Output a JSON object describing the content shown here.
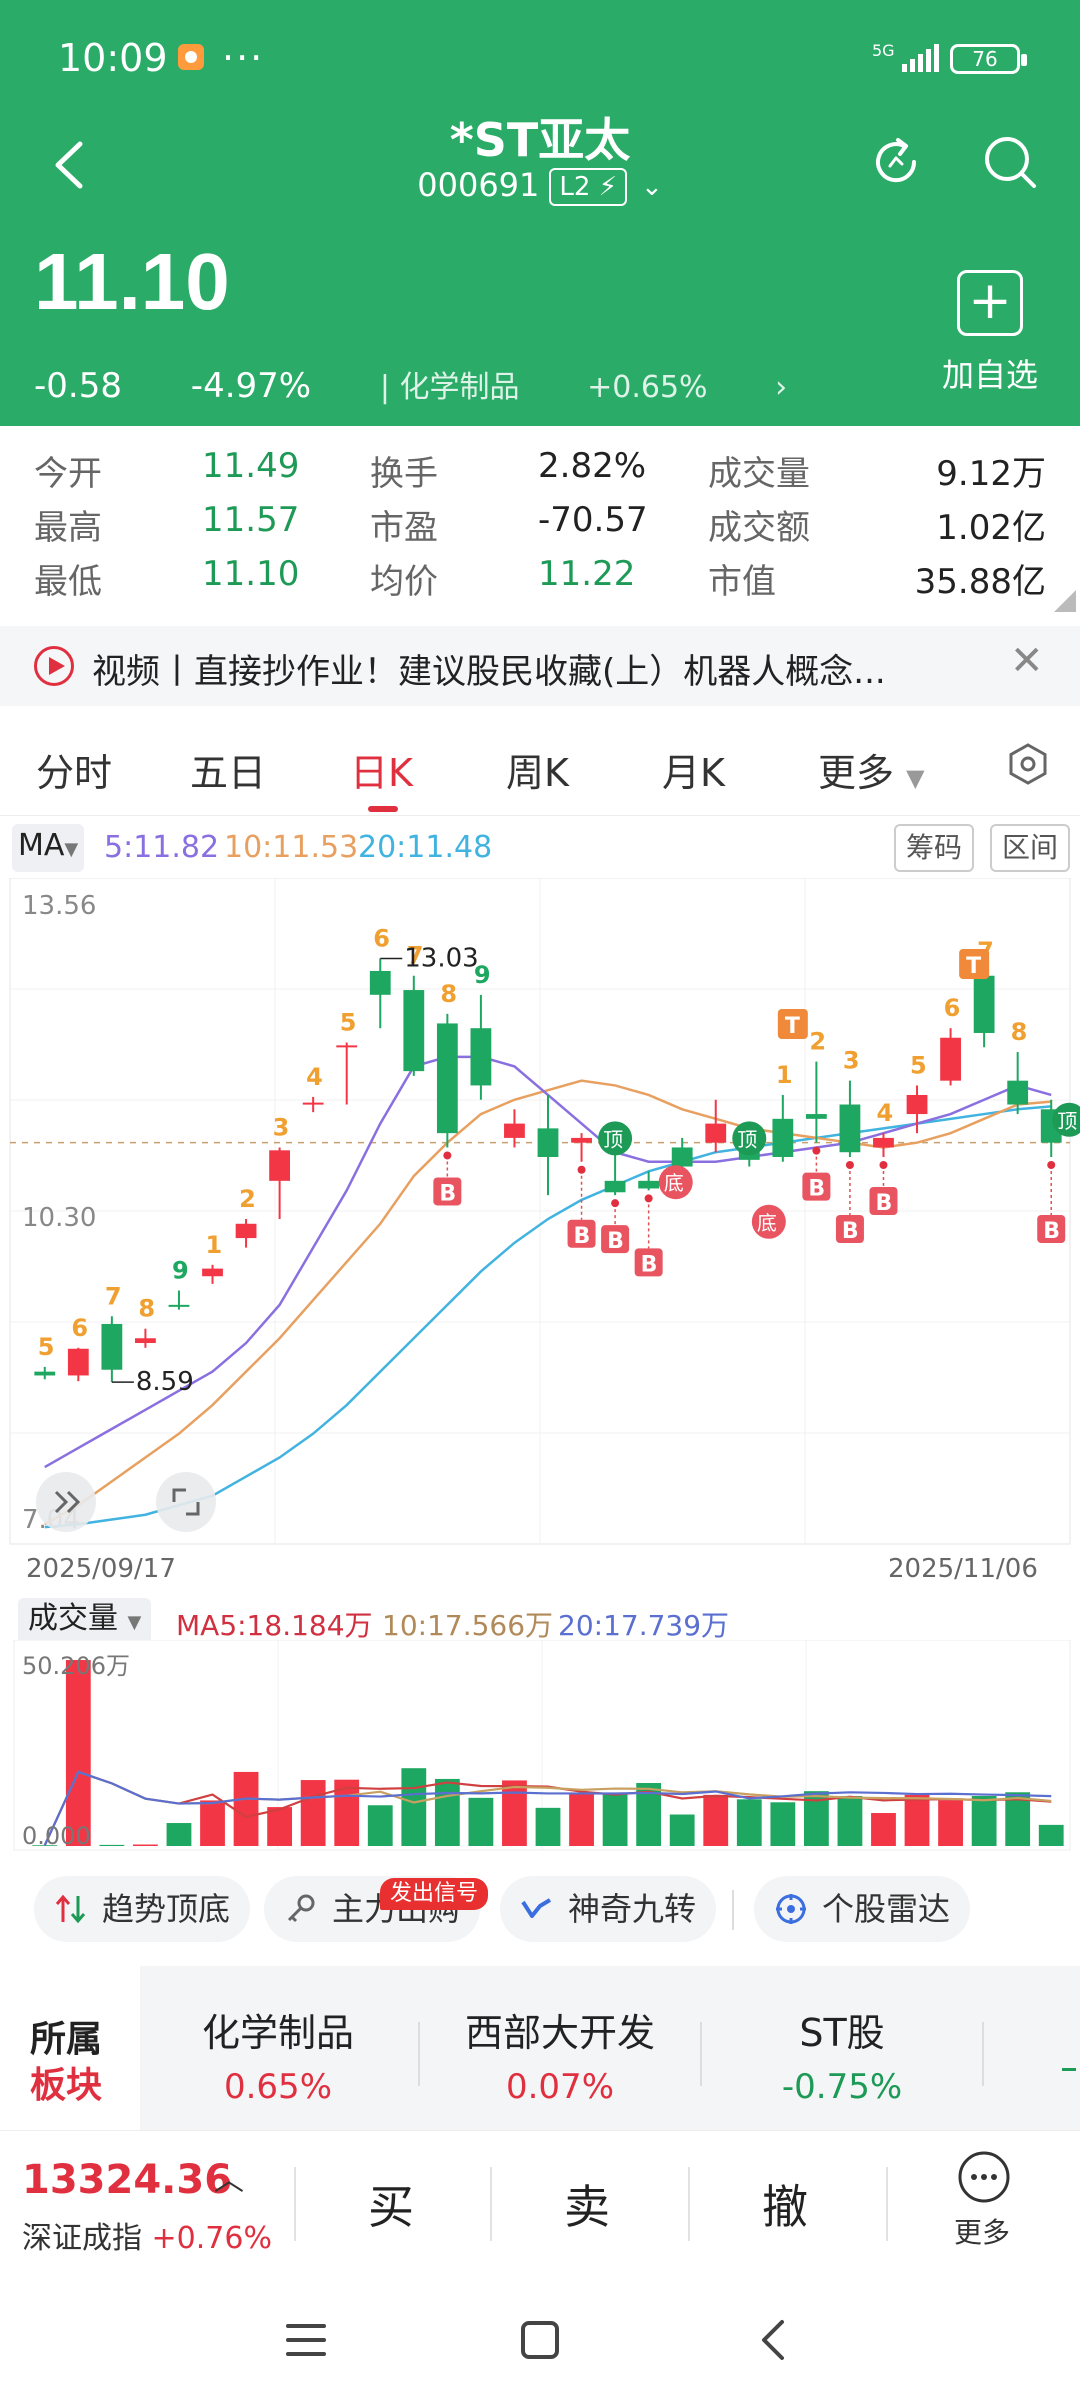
{
  "status": {
    "time": "10:09",
    "dots": "···",
    "net": "5G",
    "battery": "76"
  },
  "header": {
    "title": "*ST亚太",
    "code": "000691",
    "level": "L2",
    "price": "11.10",
    "change": "-0.58",
    "change_pct": "-4.97%",
    "sector": "化学制品",
    "sector_pct": "+0.65%",
    "add_fav": "加自选"
  },
  "stats": [
    {
      "label": "今开",
      "value": "11.49"
    },
    {
      "label": "换手",
      "value": "2.82%"
    },
    {
      "label": "成交量",
      "value": "9.12万"
    },
    {
      "label": "最高",
      "value": "11.57"
    },
    {
      "label": "市盈",
      "value": "-70.57"
    },
    {
      "label": "成交额",
      "value": "1.02亿"
    },
    {
      "label": "最低",
      "value": "11.10"
    },
    {
      "label": "均价",
      "value": "11.22"
    },
    {
      "label": "市值",
      "value": "35.88亿"
    }
  ],
  "news": {
    "text": "视频丨直接抄作业！建议股民收藏(上）机器人概念..."
  },
  "tabs": [
    "分时",
    "五日",
    "日K",
    "周K",
    "月K",
    "更多"
  ],
  "ma_legend": {
    "label": "MA",
    "ma5": "5:11.82",
    "ma10": "10:11.53",
    "ma20": "20:11.48",
    "chip1": "筹码",
    "chip2": "区间"
  },
  "chart_data": {
    "type": "candlestick",
    "dates_shown": [
      "2025/09/17",
      "2025/11/06"
    ],
    "y_labels": [
      "13.56",
      "10.30",
      "7.04"
    ],
    "ylim": [
      7.04,
      13.56
    ],
    "ref_price": 11.1,
    "high_marker": "13.03",
    "low_marker": "8.59",
    "candles": [
      {
        "o": 8.7,
        "h": 8.75,
        "l": 8.62,
        "c": 8.66,
        "n": "5"
      },
      {
        "o": 8.66,
        "h": 8.95,
        "l": 8.6,
        "c": 8.94,
        "n": "6"
      },
      {
        "o": 9.2,
        "h": 9.28,
        "l": 8.59,
        "c": 8.72,
        "n": "7"
      },
      {
        "o": 9.0,
        "h": 9.15,
        "l": 8.95,
        "c": 9.05,
        "n": "8"
      },
      {
        "o": 9.4,
        "h": 9.55,
        "l": 9.35,
        "c": 9.38,
        "n": "9"
      },
      {
        "o": 9.7,
        "h": 9.82,
        "l": 9.62,
        "c": 9.78,
        "n": "1"
      },
      {
        "o": 10.1,
        "h": 10.3,
        "l": 10.0,
        "c": 10.25,
        "n": "2"
      },
      {
        "o": 10.7,
        "h": 11.05,
        "l": 10.3,
        "c": 11.02,
        "n": "3"
      },
      {
        "o": 11.5,
        "h": 11.58,
        "l": 11.42,
        "c": 11.52,
        "n": "4"
      },
      {
        "o": 12.1,
        "h": 12.15,
        "l": 11.5,
        "c": 12.12,
        "n": "5"
      },
      {
        "o": 12.9,
        "h": 13.03,
        "l": 12.3,
        "c": 12.65,
        "n": "6"
      },
      {
        "o": 12.7,
        "h": 12.85,
        "l": 11.8,
        "c": 11.85,
        "n": "7"
      },
      {
        "o": 12.35,
        "h": 12.45,
        "l": 11.05,
        "c": 11.2,
        "n": "8"
      },
      {
        "o": 12.3,
        "h": 12.65,
        "l": 11.55,
        "c": 11.7,
        "n": "9"
      },
      {
        "o": 11.15,
        "h": 11.45,
        "l": 11.05,
        "c": 11.3,
        "n": ""
      },
      {
        "o": 11.25,
        "h": 11.6,
        "l": 10.55,
        "c": 10.95,
        "n": ""
      },
      {
        "o": 11.1,
        "h": 11.2,
        "l": 10.9,
        "c": 11.15,
        "n": ""
      },
      {
        "o": 10.7,
        "h": 11.25,
        "l": 10.55,
        "c": 10.58,
        "n": ""
      },
      {
        "o": 10.7,
        "h": 10.8,
        "l": 10.6,
        "c": 10.62,
        "n": ""
      },
      {
        "o": 11.05,
        "h": 11.15,
        "l": 10.8,
        "c": 10.85,
        "n": ""
      },
      {
        "o": 11.1,
        "h": 11.55,
        "l": 11.0,
        "c": 11.3,
        "n": ""
      },
      {
        "o": 11.1,
        "h": 11.25,
        "l": 10.85,
        "c": 10.92,
        "n": ""
      },
      {
        "o": 11.35,
        "h": 11.6,
        "l": 10.9,
        "c": 10.95,
        "n": "1"
      },
      {
        "o": 11.4,
        "h": 11.95,
        "l": 11.1,
        "c": 11.35,
        "n": "2"
      },
      {
        "o": 11.5,
        "h": 11.75,
        "l": 10.95,
        "c": 11.0,
        "n": "3"
      },
      {
        "o": 11.05,
        "h": 11.2,
        "l": 10.95,
        "c": 11.15,
        "n": "4"
      },
      {
        "o": 11.4,
        "h": 11.7,
        "l": 11.2,
        "c": 11.6,
        "n": "5"
      },
      {
        "o": 11.75,
        "h": 12.3,
        "l": 11.7,
        "c": 12.2,
        "n": "6"
      },
      {
        "o": 12.85,
        "h": 12.9,
        "l": 12.1,
        "c": 12.25,
        "n": "7"
      },
      {
        "o": 11.75,
        "h": 12.05,
        "l": 11.4,
        "c": 11.5,
        "n": "8"
      },
      {
        "o": 11.45,
        "h": 11.55,
        "l": 10.95,
        "c": 11.1,
        "n": ""
      }
    ],
    "ma5": [
      7.7,
      7.9,
      8.1,
      8.3,
      8.5,
      8.7,
      9.0,
      9.4,
      10.0,
      10.6,
      11.3,
      11.9,
      12.0,
      12.0,
      11.9,
      11.6,
      11.3,
      11.0,
      10.9,
      10.9,
      10.9,
      10.95,
      11.0,
      11.05,
      11.1,
      11.2,
      11.3,
      11.4,
      11.55,
      11.7,
      11.6
    ],
    "ma10": [
      7.1,
      7.3,
      7.55,
      7.8,
      8.05,
      8.35,
      8.7,
      9.05,
      9.45,
      9.85,
      10.25,
      10.75,
      11.1,
      11.4,
      11.55,
      11.65,
      11.75,
      11.7,
      11.6,
      11.45,
      11.35,
      11.25,
      11.2,
      11.15,
      11.1,
      11.05,
      11.1,
      11.2,
      11.35,
      11.5,
      11.53
    ],
    "ma20": [
      7.07,
      7.1,
      7.15,
      7.2,
      7.3,
      7.4,
      7.6,
      7.8,
      8.05,
      8.35,
      8.7,
      9.05,
      9.4,
      9.75,
      10.05,
      10.3,
      10.5,
      10.65,
      10.8,
      10.9,
      11.0,
      11.05,
      11.1,
      11.15,
      11.2,
      11.25,
      11.3,
      11.35,
      11.4,
      11.45,
      11.48
    ],
    "buy_points": [
      12,
      16,
      17,
      18,
      23,
      24,
      25,
      30
    ],
    "top_points": [
      17,
      21,
      30
    ],
    "bottom_points": [
      20,
      22
    ],
    "t_points": [
      22,
      28
    ],
    "volume": {
      "title": "成交量",
      "ma5": "MA5:18.184万",
      "ma10": "10:17.566万",
      "ma20": "20:17.739万",
      "max_label": "50.206万",
      "min_label": "0.000",
      "values": [
        0.2,
        50.2,
        0.3,
        0.4,
        6.2,
        12.3,
        20.0,
        10.5,
        17.8,
        17.9,
        11.0,
        21.0,
        18.1,
        13.0,
        17.7,
        10.3,
        14.2,
        14.1,
        17.0,
        8.5,
        13.8,
        12.6,
        11.8,
        14.8,
        13.5,
        8.9,
        13.8,
        12.3,
        13.5,
        14.5,
        5.7
      ]
    }
  },
  "pills": [
    {
      "label": "趋势顶底"
    },
    {
      "label": "主力出购",
      "badge": "发出信号"
    },
    {
      "label": "神奇九转"
    },
    {
      "label": "个股雷达"
    }
  ],
  "sectors": {
    "label1": "所属",
    "label2": "板块",
    "items": [
      {
        "name": "化学制品",
        "pct": "0.65%",
        "color": "#e03040"
      },
      {
        "name": "西部大开发",
        "pct": "0.07%",
        "color": "#e03040"
      },
      {
        "name": "ST股",
        "pct": "-0.75%",
        "color": "#1e9a57"
      }
    ]
  },
  "tradebar": {
    "index_value": "13324.36",
    "index_name": "深证成指",
    "index_pct": "+0.76%",
    "buy": "买",
    "sell": "卖",
    "cancel": "撤",
    "more": "更多"
  }
}
